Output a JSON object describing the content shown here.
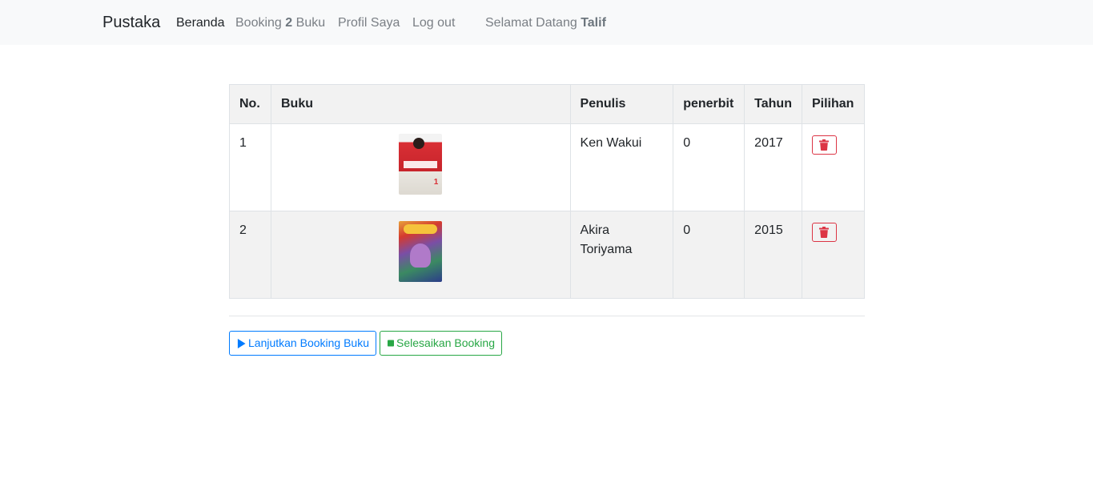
{
  "navbar": {
    "brand": "Pustaka",
    "links": [
      {
        "label": "Beranda",
        "active": true
      },
      {
        "label_prefix": "Booking",
        "count": "2",
        "label_suffix": "Buku"
      },
      {
        "label": "Profil Saya"
      },
      {
        "label": "Log out"
      }
    ],
    "welcome": {
      "prefix": "Selamat Datang",
      "user": "Talif"
    }
  },
  "table": {
    "headers": [
      "No.",
      "Buku",
      "Penulis",
      "penerbit",
      "Tahun",
      "Pilihan"
    ],
    "rows": [
      {
        "no": "1",
        "cover_icon": "book-cover-red",
        "penulis": "Ken Wakui",
        "penerbit": "0",
        "tahun": "2017"
      },
      {
        "no": "2",
        "cover_icon": "book-cover-multicolor",
        "penulis": "Akira Toriyama",
        "penerbit": "0",
        "tahun": "2015"
      }
    ],
    "delete_icon": "trash-icon"
  },
  "actions": {
    "continue_label": "Lanjutkan Booking Buku",
    "finish_label": "Selesaikan Booking"
  },
  "colors": {
    "primary": "#007bff",
    "success": "#28a745",
    "danger": "#dc3545",
    "navbar_bg": "#f8f9fa",
    "stripe": "#f2f2f2"
  }
}
